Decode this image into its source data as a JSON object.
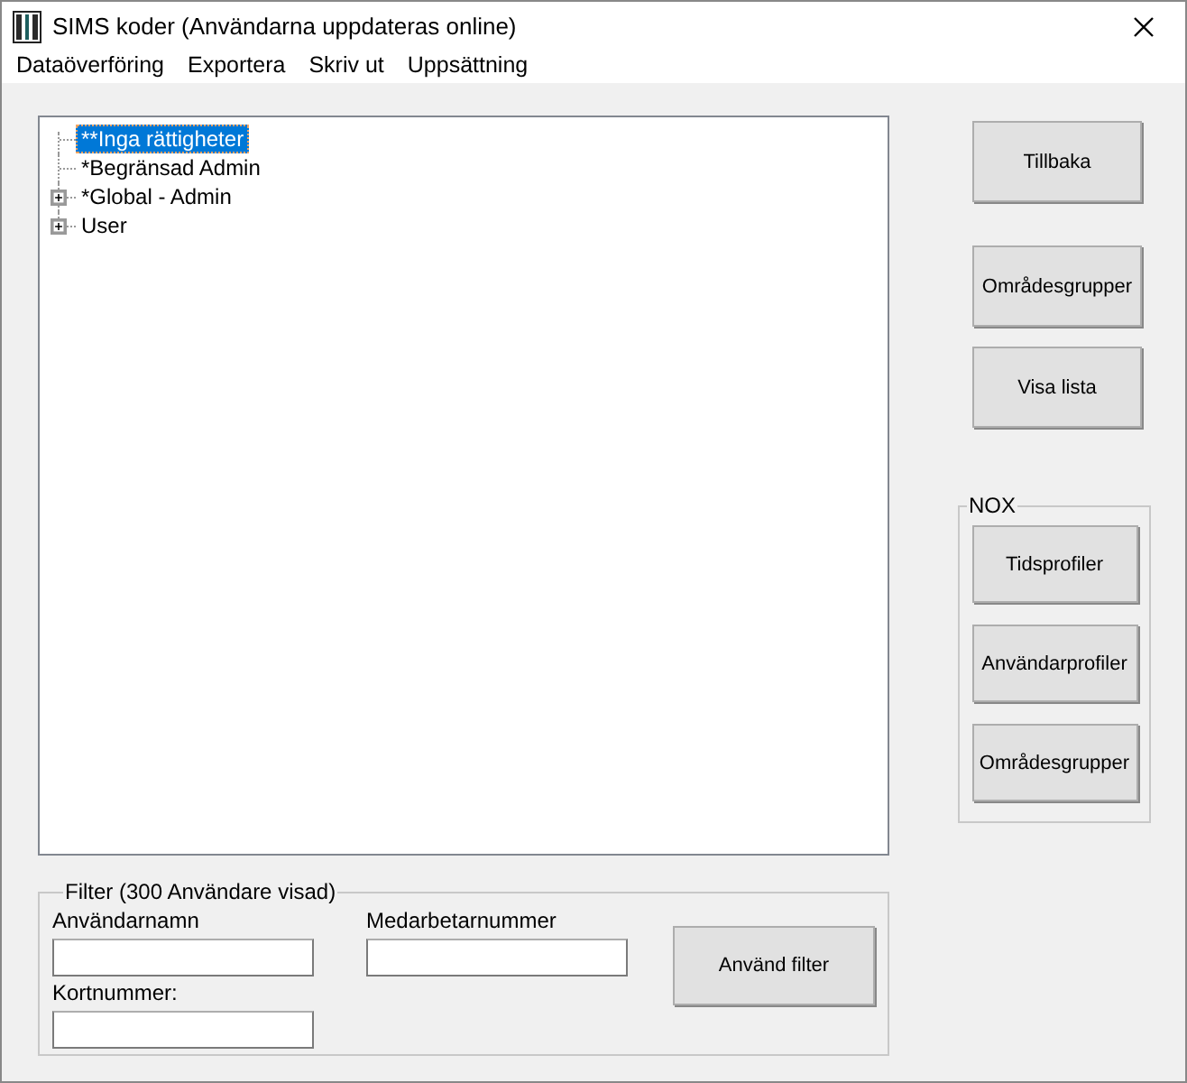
{
  "window": {
    "title": "SIMS koder (Användarna uppdateras online)"
  },
  "menu": [
    "Dataöverföring",
    "Exportera",
    "Skriv ut",
    "Uppsättning"
  ],
  "tree": [
    {
      "label": "**Inga rättigheter",
      "selected": true,
      "expandable": false
    },
    {
      "label": "*Begränsad Admin",
      "selected": false,
      "expandable": false
    },
    {
      "label": "*Global - Admin",
      "selected": false,
      "expandable": true
    },
    {
      "label": "User",
      "selected": false,
      "expandable": true
    }
  ],
  "buttons": [
    "Tillbaka",
    "Områdesgrupper",
    "Visa lista"
  ],
  "nox": {
    "title": "NOX",
    "buttons": [
      "Tidsprofiler",
      "Användarprofiler",
      "Områdesgrupper"
    ]
  },
  "filter": {
    "title": "Filter (300 Användare visad)",
    "username_label": "Användarnamn",
    "employee_label": "Medarbetarnummer",
    "card_label": "Kortnummer:",
    "apply": "Använd filter"
  }
}
